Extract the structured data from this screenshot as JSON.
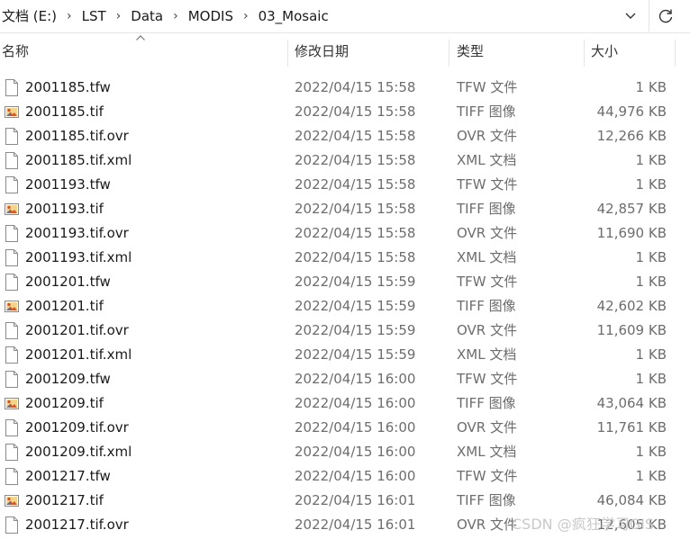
{
  "address_bar": {
    "crumbs": [
      "文档 (E:)",
      "LST",
      "Data",
      "MODIS",
      "03_Mosaic"
    ]
  },
  "columns": {
    "name": "名称",
    "date": "修改日期",
    "type": "类型",
    "size": "大小"
  },
  "files": [
    {
      "name": "2001185.tfw",
      "date": "2022/04/15 15:58",
      "type": "TFW 文件",
      "size": "1 KB",
      "icon": "file-icon"
    },
    {
      "name": "2001185.tif",
      "date": "2022/04/15 15:58",
      "type": "TIFF 图像",
      "size": "44,976 KB",
      "icon": "image-file-icon"
    },
    {
      "name": "2001185.tif.ovr",
      "date": "2022/04/15 15:58",
      "type": "OVR 文件",
      "size": "12,266 KB",
      "icon": "file-icon"
    },
    {
      "name": "2001185.tif.xml",
      "date": "2022/04/15 15:58",
      "type": "XML 文档",
      "size": "1 KB",
      "icon": "file-icon"
    },
    {
      "name": "2001193.tfw",
      "date": "2022/04/15 15:58",
      "type": "TFW 文件",
      "size": "1 KB",
      "icon": "file-icon"
    },
    {
      "name": "2001193.tif",
      "date": "2022/04/15 15:58",
      "type": "TIFF 图像",
      "size": "42,857 KB",
      "icon": "image-file-icon"
    },
    {
      "name": "2001193.tif.ovr",
      "date": "2022/04/15 15:58",
      "type": "OVR 文件",
      "size": "11,690 KB",
      "icon": "file-icon"
    },
    {
      "name": "2001193.tif.xml",
      "date": "2022/04/15 15:58",
      "type": "XML 文档",
      "size": "1 KB",
      "icon": "file-icon"
    },
    {
      "name": "2001201.tfw",
      "date": "2022/04/15 15:59",
      "type": "TFW 文件",
      "size": "1 KB",
      "icon": "file-icon"
    },
    {
      "name": "2001201.tif",
      "date": "2022/04/15 15:59",
      "type": "TIFF 图像",
      "size": "42,602 KB",
      "icon": "image-file-icon"
    },
    {
      "name": "2001201.tif.ovr",
      "date": "2022/04/15 15:59",
      "type": "OVR 文件",
      "size": "11,609 KB",
      "icon": "file-icon"
    },
    {
      "name": "2001201.tif.xml",
      "date": "2022/04/15 15:59",
      "type": "XML 文档",
      "size": "1 KB",
      "icon": "file-icon"
    },
    {
      "name": "2001209.tfw",
      "date": "2022/04/15 16:00",
      "type": "TFW 文件",
      "size": "1 KB",
      "icon": "file-icon"
    },
    {
      "name": "2001209.tif",
      "date": "2022/04/15 16:00",
      "type": "TIFF 图像",
      "size": "43,064 KB",
      "icon": "image-file-icon"
    },
    {
      "name": "2001209.tif.ovr",
      "date": "2022/04/15 16:00",
      "type": "OVR 文件",
      "size": "11,761 KB",
      "icon": "file-icon"
    },
    {
      "name": "2001209.tif.xml",
      "date": "2022/04/15 16:00",
      "type": "XML 文档",
      "size": "1 KB",
      "icon": "file-icon"
    },
    {
      "name": "2001217.tfw",
      "date": "2022/04/15 16:00",
      "type": "TFW 文件",
      "size": "1 KB",
      "icon": "file-icon"
    },
    {
      "name": "2001217.tif",
      "date": "2022/04/15 16:01",
      "type": "TIFF 图像",
      "size": "46,084 KB",
      "icon": "image-file-icon"
    },
    {
      "name": "2001217.tif.ovr",
      "date": "2022/04/15 16:01",
      "type": "OVR 文件",
      "size": "12,605 KB",
      "icon": "file-icon"
    }
  ],
  "watermark": "CSDN @疯狂学习GIS",
  "colors": {
    "secondary_text": "#6d6d6d",
    "separator": "#e5e5e5"
  }
}
